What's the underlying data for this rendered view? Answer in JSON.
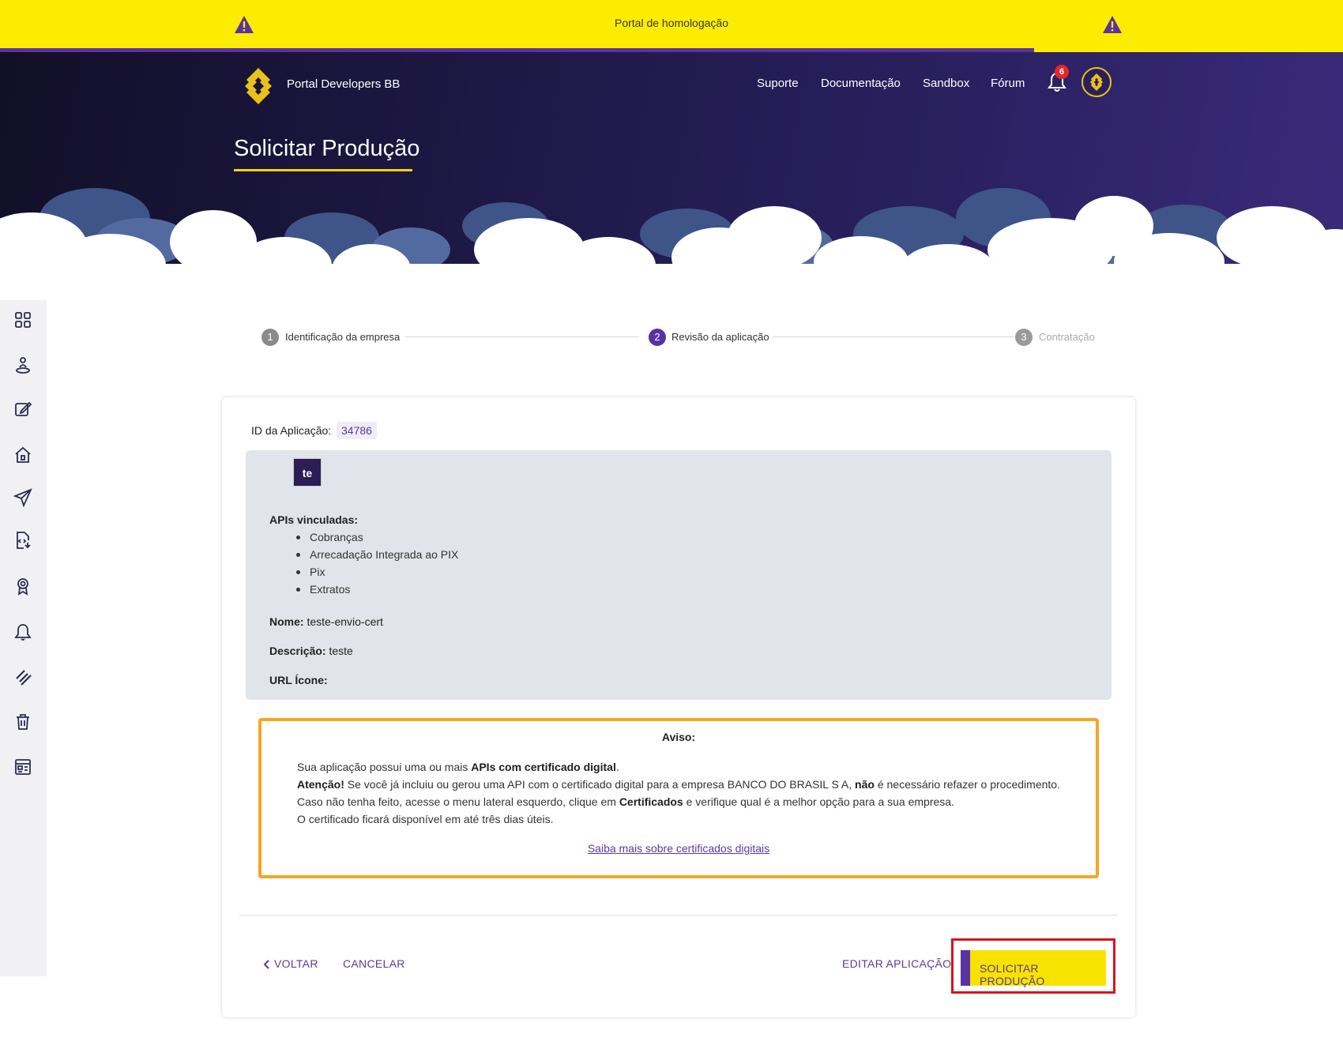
{
  "banner": {
    "text": "Portal de homologação",
    "progress_fraction": 0.77
  },
  "header": {
    "brand": "Portal Developers BB",
    "nav": [
      "Suporte",
      "Documentação",
      "Sandbox",
      "Fórum"
    ],
    "notification_count": "6",
    "page_title": "Solicitar Produção"
  },
  "sidebar": {
    "icons": [
      "dashboard-icon",
      "user-pin-icon",
      "edit-icon",
      "home-icon",
      "send-icon",
      "document-code-icon",
      "certificate-icon",
      "bell-icon",
      "link-icon",
      "trash-icon",
      "layout-icon"
    ]
  },
  "stepper": {
    "steps": [
      {
        "num": "1",
        "label": "Identificação da empresa",
        "state": "done"
      },
      {
        "num": "2",
        "label": "Revisão da aplicação",
        "state": "active"
      },
      {
        "num": "3",
        "label": "Contratação",
        "state": "pending"
      }
    ]
  },
  "app": {
    "id_label": "ID da Aplicação:",
    "id_value": "34786",
    "icon_text": "te",
    "apis_label": "APIs vinculadas:",
    "apis": [
      "Cobranças",
      "Arrecadação Integrada ao PIX",
      "Pix",
      "Extratos"
    ],
    "name_label": "Nome:",
    "name_value": "teste-envio-cert",
    "desc_label": "Descrição:",
    "desc_value": "teste",
    "url_label": "URL Ícone:",
    "url_value": ""
  },
  "notice": {
    "title": "Aviso:",
    "line1_a": "Sua aplicação possui uma ou mais ",
    "line1_b": "APIs com certificado digital",
    "line1_c": ".",
    "line2_a": "Atenção!",
    "line2_b": " Se você já incluiu ou gerou uma API com o certificado digital para a empresa BANCO DO BRASIL S A, ",
    "line2_c": "não",
    "line2_d": " é necessário refazer o procedimento.",
    "line3_a": "Caso não tenha feito, acesse o menu lateral esquerdo, clique em ",
    "line3_b": "Certificados",
    "line3_c": " e verifique qual é a melhor opção para a sua empresa.",
    "line4": "O certificado ficará disponível em até três dias úteis.",
    "link": "Saiba mais sobre certificados digitais"
  },
  "actions": {
    "back": "VOLTAR",
    "cancel": "CANCELAR",
    "edit": "EDITAR APLICAÇÃO",
    "submit": "SOLICITAR PRODUÇÃO"
  },
  "colors": {
    "banner_yellow": "#fcec00",
    "brand_purple": "#5a32a3",
    "header_dark": "#1f1948",
    "notice_orange": "#f5a623",
    "highlight_red": "#d9131f"
  }
}
